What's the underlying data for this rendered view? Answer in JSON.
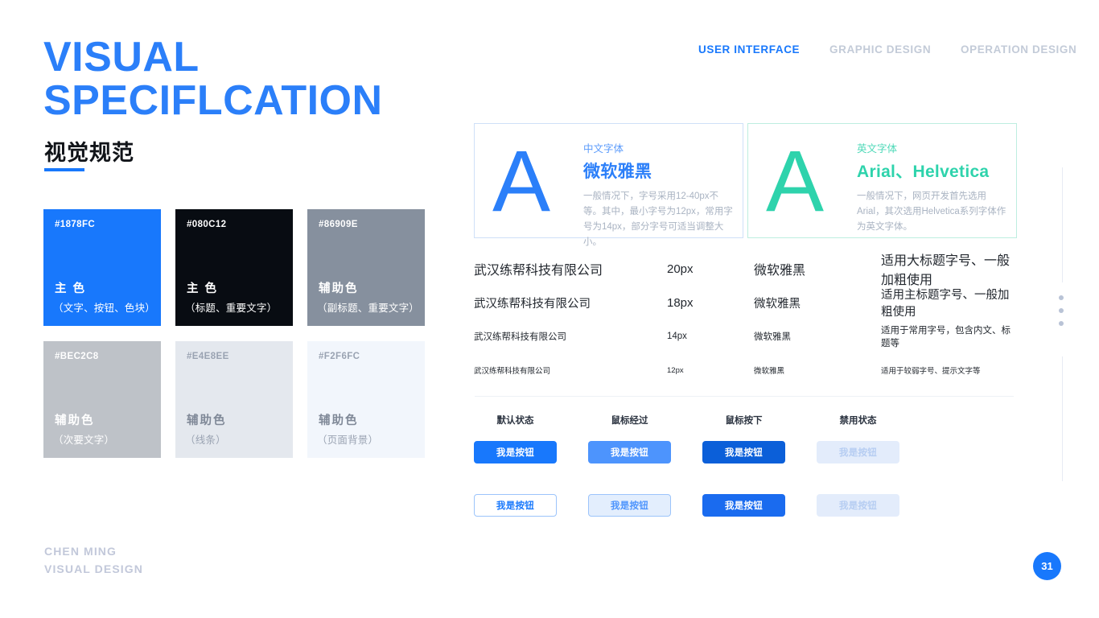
{
  "nav": {
    "items": [
      {
        "label": "USER INTERFACE",
        "active": true
      },
      {
        "label": "GRAPHIC DESIGN",
        "active": false
      },
      {
        "label": "OPERATION DESIGN",
        "active": false
      }
    ]
  },
  "title": {
    "line1": "VISUAL",
    "line2": "SPECIFLCATION",
    "chinese": "视觉规范",
    "accent_color": "#2B7FF9"
  },
  "swatches": [
    {
      "hex": "#1878FC",
      "name": "主 色",
      "use": "（文字、按钮、色块）",
      "bg": "#1878FC",
      "hex_color": "#ffffff",
      "name_color": "#ffffff",
      "use_color": "#ffffff"
    },
    {
      "hex": "#080C12",
      "name": "主 色",
      "use": "（标题、重要文字）",
      "bg": "#080C12",
      "hex_color": "#ffffff",
      "name_color": "#ffffff",
      "use_color": "#ffffff"
    },
    {
      "hex": "#86909E",
      "name": "辅助色",
      "use": "（副标题、重要文字）",
      "bg": "#86909E",
      "hex_color": "#ffffff",
      "name_color": "#ffffff",
      "use_color": "#ffffff"
    },
    {
      "hex": "#BEC2C8",
      "name": "辅助色",
      "use": "（次要文字）",
      "bg": "#BEC2C8",
      "hex_color": "#ffffff",
      "name_color": "#ffffff",
      "use_color": "#ffffff"
    },
    {
      "hex": "#E4E8EE",
      "name": "辅助色",
      "use": "（线条）",
      "bg": "#E4E8EE",
      "hex_color": "#9aa3b2",
      "name_color": "#7f8897",
      "use_color": "#9aa3b2"
    },
    {
      "hex": "#F2F6FC",
      "name": "辅助色",
      "use": "（页面背景）",
      "bg": "#F2F6FC",
      "hex_color": "#9aa3b2",
      "name_color": "#7f8897",
      "use_color": "#9aa3b2"
    }
  ],
  "font_cards": [
    {
      "glyph": "A",
      "label": "中文字体",
      "title": "微软雅黑",
      "desc": "一般情况下，字号采用12-40px不等。其中，最小字号为12px，常用字号为14px，部分字号可适当调整大小。",
      "color": "#2B7FF9"
    },
    {
      "glyph": "A",
      "label": "英文字体",
      "title": "Arial、Helvetica",
      "desc": "一般情况下，网页开发首先选用Arial，其次选用Helvetica系列字体作为英文字体。",
      "color": "#2ED3AC"
    }
  ],
  "spec_table": {
    "rows": [
      {
        "sample": "武汉练帮科技有限公司",
        "size": "20px",
        "family": "微软雅黑",
        "note": "适用大标题字号、一般加粗使用"
      },
      {
        "sample": "武汉练帮科技有限公司",
        "size": "18px",
        "family": "微软雅黑",
        "note": "适用主标题字号、一般加粗使用"
      },
      {
        "sample": "武汉练帮科技有限公司",
        "size": "14px",
        "family": "微软雅黑",
        "note": "适用于常用字号，包含内文、标题等"
      },
      {
        "sample": "武汉练帮科技有限公司",
        "size": "12px",
        "family": "微软雅黑",
        "note": "适用于较弱字号、提示文字等"
      }
    ]
  },
  "buttons": {
    "states": [
      "默认状态",
      "鼠标经过",
      "鼠标按下",
      "禁用状态"
    ],
    "row_primary": [
      {
        "label": "我是按钮",
        "style": "fill-default"
      },
      {
        "label": "我是按钮",
        "style": "fill-hover"
      },
      {
        "label": "我是按钮",
        "style": "fill-active"
      },
      {
        "label": "我是按钮",
        "style": "fill-disabled"
      }
    ],
    "row_secondary": [
      {
        "label": "我是按钮",
        "style": "out-default"
      },
      {
        "label": "我是按钮",
        "style": "out-hover"
      },
      {
        "label": "我是按钮",
        "style": "out-active"
      },
      {
        "label": "我是按钮",
        "style": "out-disabled"
      }
    ]
  },
  "footer": {
    "line1": "CHEN MING",
    "line2": "VISUAL DESIGN"
  },
  "page_number": "31"
}
